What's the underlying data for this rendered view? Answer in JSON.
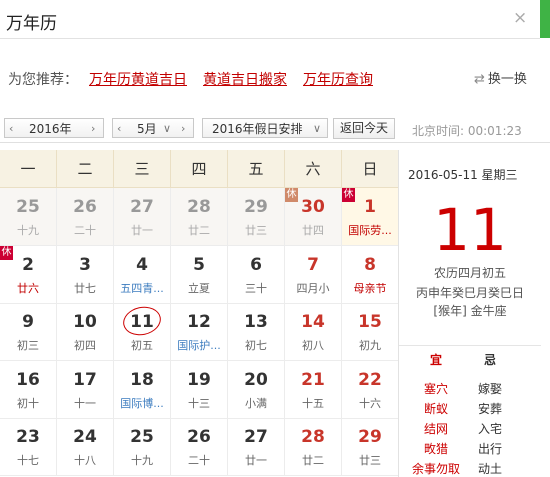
{
  "search": {
    "query": "万年历",
    "clear": "×"
  },
  "recommend": {
    "label": "为您推荐：",
    "links": [
      "万年历黄道吉日",
      "黄道吉日搬家",
      "万年历查询"
    ],
    "swap": "换一换"
  },
  "toolbar": {
    "year": "2016年",
    "month": "5月",
    "holiday": "2016年假日安排",
    "today": "返回今天",
    "time_label": "北京时间: 00:01:23"
  },
  "weekdays": [
    "一",
    "二",
    "三",
    "四",
    "五",
    "六",
    "日"
  ],
  "weeks": [
    [
      {
        "d": "25",
        "l": "十九",
        "prev": true
      },
      {
        "d": "26",
        "l": "二十",
        "prev": true
      },
      {
        "d": "27",
        "l": "廿一",
        "prev": true
      },
      {
        "d": "28",
        "l": "廿二",
        "prev": true
      },
      {
        "d": "29",
        "l": "廿三",
        "prev": true
      },
      {
        "d": "30",
        "l": "廿四",
        "prev": true,
        "red": true,
        "rest": "休"
      },
      {
        "d": "1",
        "l": "国际劳...",
        "red": true,
        "rest": "休",
        "lc": "red",
        "hl": true
      }
    ],
    [
      {
        "d": "2",
        "l": "廿六",
        "rest": "休",
        "lc": "red"
      },
      {
        "d": "3",
        "l": "廿七"
      },
      {
        "d": "4",
        "l": "五四青...",
        "lc": "blue"
      },
      {
        "d": "5",
        "l": "立夏"
      },
      {
        "d": "6",
        "l": "三十"
      },
      {
        "d": "7",
        "l": "四月小",
        "red": true
      },
      {
        "d": "8",
        "l": "母亲节",
        "red": true,
        "lc": "red"
      }
    ],
    [
      {
        "d": "9",
        "l": "初三"
      },
      {
        "d": "10",
        "l": "初四"
      },
      {
        "d": "11",
        "l": "初五",
        "today": true
      },
      {
        "d": "12",
        "l": "国际护...",
        "lc": "blue"
      },
      {
        "d": "13",
        "l": "初七"
      },
      {
        "d": "14",
        "l": "初八",
        "red": true
      },
      {
        "d": "15",
        "l": "初九",
        "red": true
      }
    ],
    [
      {
        "d": "16",
        "l": "初十"
      },
      {
        "d": "17",
        "l": "十一"
      },
      {
        "d": "18",
        "l": "国际博...",
        "lc": "blue"
      },
      {
        "d": "19",
        "l": "十三"
      },
      {
        "d": "20",
        "l": "小满"
      },
      {
        "d": "21",
        "l": "十五",
        "red": true
      },
      {
        "d": "22",
        "l": "十六",
        "red": true
      }
    ],
    [
      {
        "d": "23",
        "l": "十七"
      },
      {
        "d": "24",
        "l": "十八"
      },
      {
        "d": "25",
        "l": "十九"
      },
      {
        "d": "26",
        "l": "二十"
      },
      {
        "d": "27",
        "l": "廿一"
      },
      {
        "d": "28",
        "l": "廿二",
        "red": true
      },
      {
        "d": "29",
        "l": "廿三",
        "red": true
      }
    ]
  ],
  "detail": {
    "date": "2016-05-11  星期三",
    "big": "11",
    "lunar": "农历四月初五",
    "ganzhi": "丙申年癸巳月癸巳日",
    "zodiac": "[猴年] 金牛座",
    "yi_label": "宜",
    "ji_label": "忌",
    "yi": [
      "塞穴",
      "断蚁",
      "结网",
      "畋猎",
      "余事勿取"
    ],
    "ji": [
      "嫁娶",
      "安葬",
      "入宅",
      "出行",
      "动土"
    ]
  }
}
